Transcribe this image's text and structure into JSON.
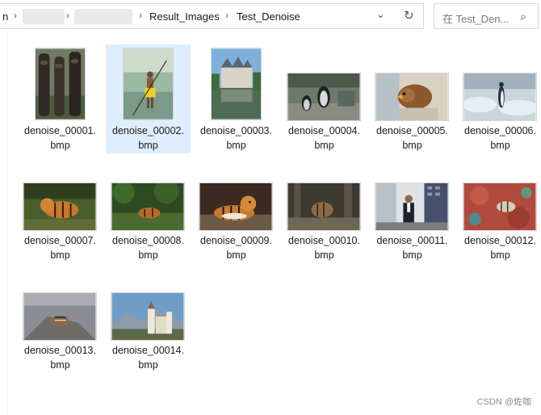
{
  "address_bar": {
    "crumbs": [
      "n",
      "Result_Images",
      "Test_Denoise"
    ],
    "chevron_label": "⌄",
    "refresh_label": "↻"
  },
  "search": {
    "text": "在 Test_Den...",
    "icon": "⌕"
  },
  "files": [
    {
      "name_line1": "denoise_00001.",
      "name_line2": "bmp",
      "thumbnail": "tribal-statues",
      "selected": false
    },
    {
      "name_line1": "denoise_00002.",
      "name_line2": "bmp",
      "thumbnail": "boatman-yellow-skirt",
      "selected": true
    },
    {
      "name_line1": "denoise_00003.",
      "name_line2": "bmp",
      "thumbnail": "castle-reflection",
      "selected": false
    },
    {
      "name_line1": "denoise_00004.",
      "name_line2": "bmp",
      "thumbnail": "penguins-rocks",
      "selected": false
    },
    {
      "name_line1": "denoise_00005.",
      "name_line2": "bmp",
      "thumbnail": "bird-close-up",
      "selected": false
    },
    {
      "name_line1": "denoise_00006.",
      "name_line2": "bmp",
      "thumbnail": "penguin-snow",
      "selected": false
    },
    {
      "name_line1": "denoise_00007.",
      "name_line2": "bmp",
      "thumbnail": "tiger-grass",
      "selected": false
    },
    {
      "name_line1": "denoise_00008.",
      "name_line2": "bmp",
      "thumbnail": "tiger-forest",
      "selected": false
    },
    {
      "name_line1": "denoise_00009.",
      "name_line2": "bmp",
      "thumbnail": "tiger-lying",
      "selected": false
    },
    {
      "name_line1": "denoise_00010.",
      "name_line2": "bmp",
      "thumbnail": "tiger-dark-forest",
      "selected": false
    },
    {
      "name_line1": "denoise_00011.",
      "name_line2": "bmp",
      "thumbnail": "man-buildings",
      "selected": false
    },
    {
      "name_line1": "denoise_00012.",
      "name_line2": "bmp",
      "thumbnail": "coral-fish",
      "selected": false
    },
    {
      "name_line1": "denoise_00013.",
      "name_line2": "bmp",
      "thumbnail": "chipmunk-rock",
      "selected": false
    },
    {
      "name_line1": "denoise_00014.",
      "name_line2": "bmp",
      "thumbnail": "church-mountains",
      "selected": false
    }
  ],
  "watermark": "CSDN @佐咖"
}
